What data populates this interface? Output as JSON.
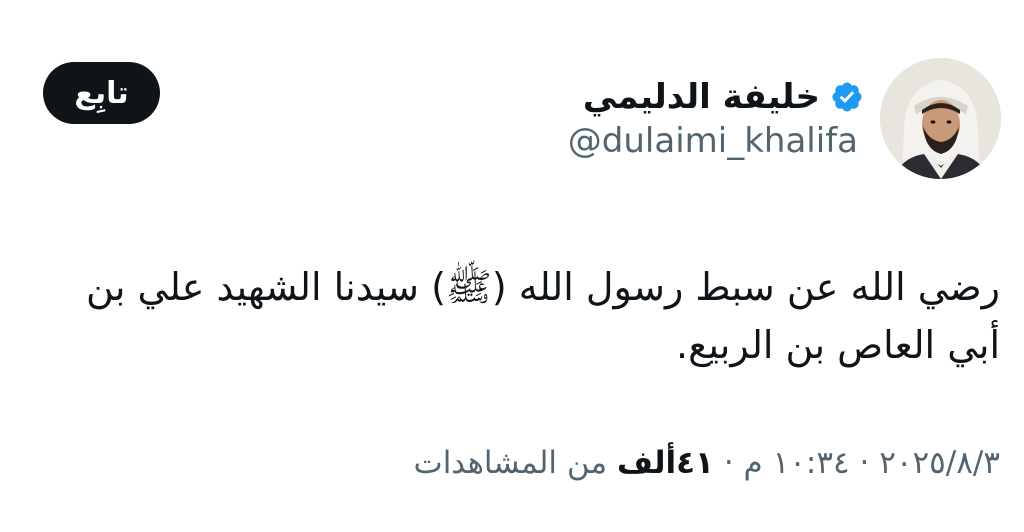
{
  "author": {
    "display_name": "خليفة الدليمي",
    "handle": "@dulaimi_khalifa",
    "verified": true
  },
  "follow_button": {
    "label": "تابِع"
  },
  "tweet": {
    "text_line1": "رضي الله عن سبط رسول الله (ﷺ) سيدنا الشهيد علي بن",
    "text_line2": "أبي العاص بن الربيع."
  },
  "meta": {
    "date": "٢٠٢٥/٨/٣",
    "separator": " · ",
    "time": "١٠:٣٤ م",
    "views_count": "٤١ألف",
    "views_label": "من المشاهدات"
  },
  "colors": {
    "verified": "#1d9bf0",
    "text_primary": "#0f1419",
    "text_secondary": "#536471",
    "button_bg": "#0f1419"
  },
  "icons": {
    "verified": "verified-badge-icon"
  }
}
